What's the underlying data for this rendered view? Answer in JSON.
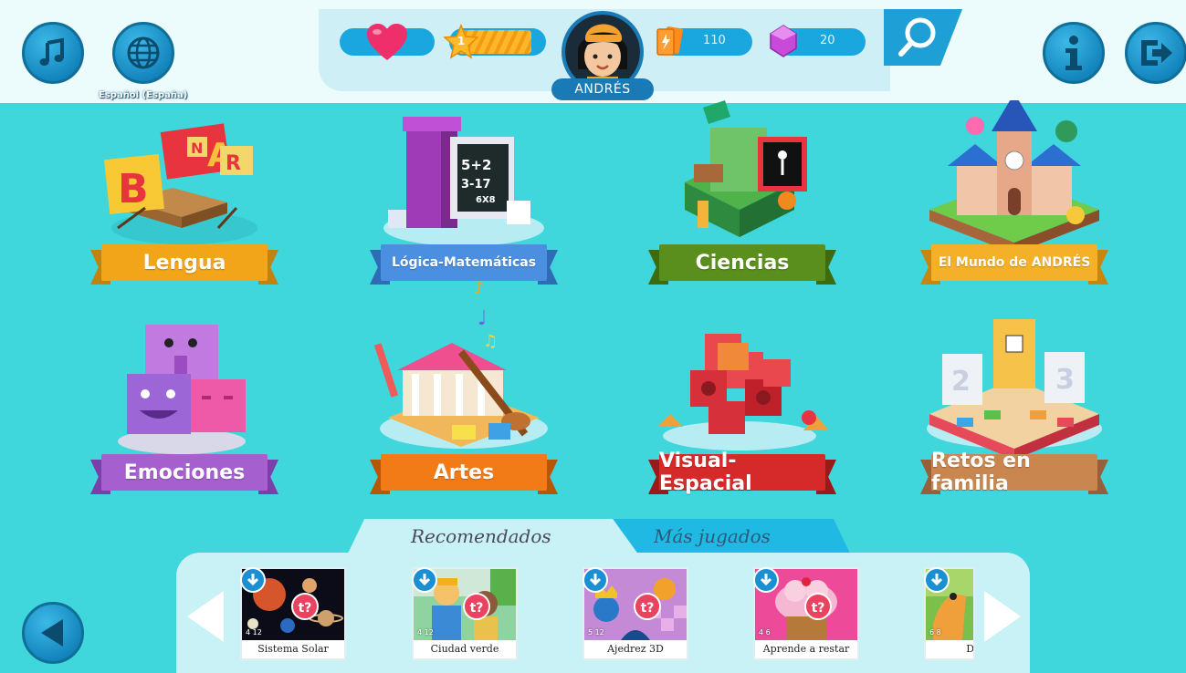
{
  "top": {
    "language_label": "Español (España)",
    "level": "1",
    "cards_count": "110",
    "gems_count": "20",
    "user_name": "ANDRÉS"
  },
  "categories": [
    {
      "label": "Lengua",
      "color": "#f3a51a"
    },
    {
      "label": "Lógica-Matemáticas",
      "color": "#4a8fe0"
    },
    {
      "label": "Ciencias",
      "color": "#5a8f1d"
    },
    {
      "label": "El Mundo de ANDRÉS",
      "color": "#f5b02a"
    },
    {
      "label": "Emociones",
      "color": "#a65fcf"
    },
    {
      "label": "Artes",
      "color": "#f27a17"
    },
    {
      "label": "Visual-Espacial",
      "color": "#d62929"
    },
    {
      "label": "Retos en familia",
      "color": "#c9874f"
    }
  ],
  "tabs": {
    "recommended": "Recomendados",
    "most_played": "Más jugados"
  },
  "games": [
    {
      "title": "Sistema Solar",
      "ages": "4 12"
    },
    {
      "title": "Ciudad verde",
      "ages": "4 12"
    },
    {
      "title": "Ajedrez 3D",
      "ages": "5 12"
    },
    {
      "title": "Aprende a restar",
      "ages": "4 6"
    },
    {
      "title": "Din",
      "ages": "6 8"
    }
  ],
  "colors": {
    "background": "#3fd6dc",
    "accent_blue": "#1a7ab6",
    "heart": "#ef2f6b"
  }
}
